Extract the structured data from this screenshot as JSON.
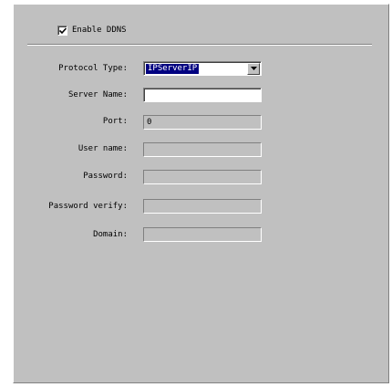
{
  "ddns": {
    "enable_label": "Enable DDNS",
    "enabled": true
  },
  "form": {
    "protocol_type": {
      "label": "Protocol Type:",
      "value": "IPServerIP"
    },
    "server_name": {
      "label": "Server Name:",
      "value": ""
    },
    "port": {
      "label": "Port:",
      "value": "0"
    },
    "user_name": {
      "label": "User name:",
      "value": ""
    },
    "password": {
      "label": "Password:",
      "value": ""
    },
    "password_verify": {
      "label": "Password verify:",
      "value": ""
    },
    "domain": {
      "label": "Domain:",
      "value": ""
    }
  },
  "icons": {
    "checkbox_mark": "check-icon",
    "dropdown": "chevron-down-icon"
  },
  "colors": {
    "panel_bg": "#c0c0c0",
    "selection_bg": "#000080",
    "selection_text": "#ffffff"
  }
}
